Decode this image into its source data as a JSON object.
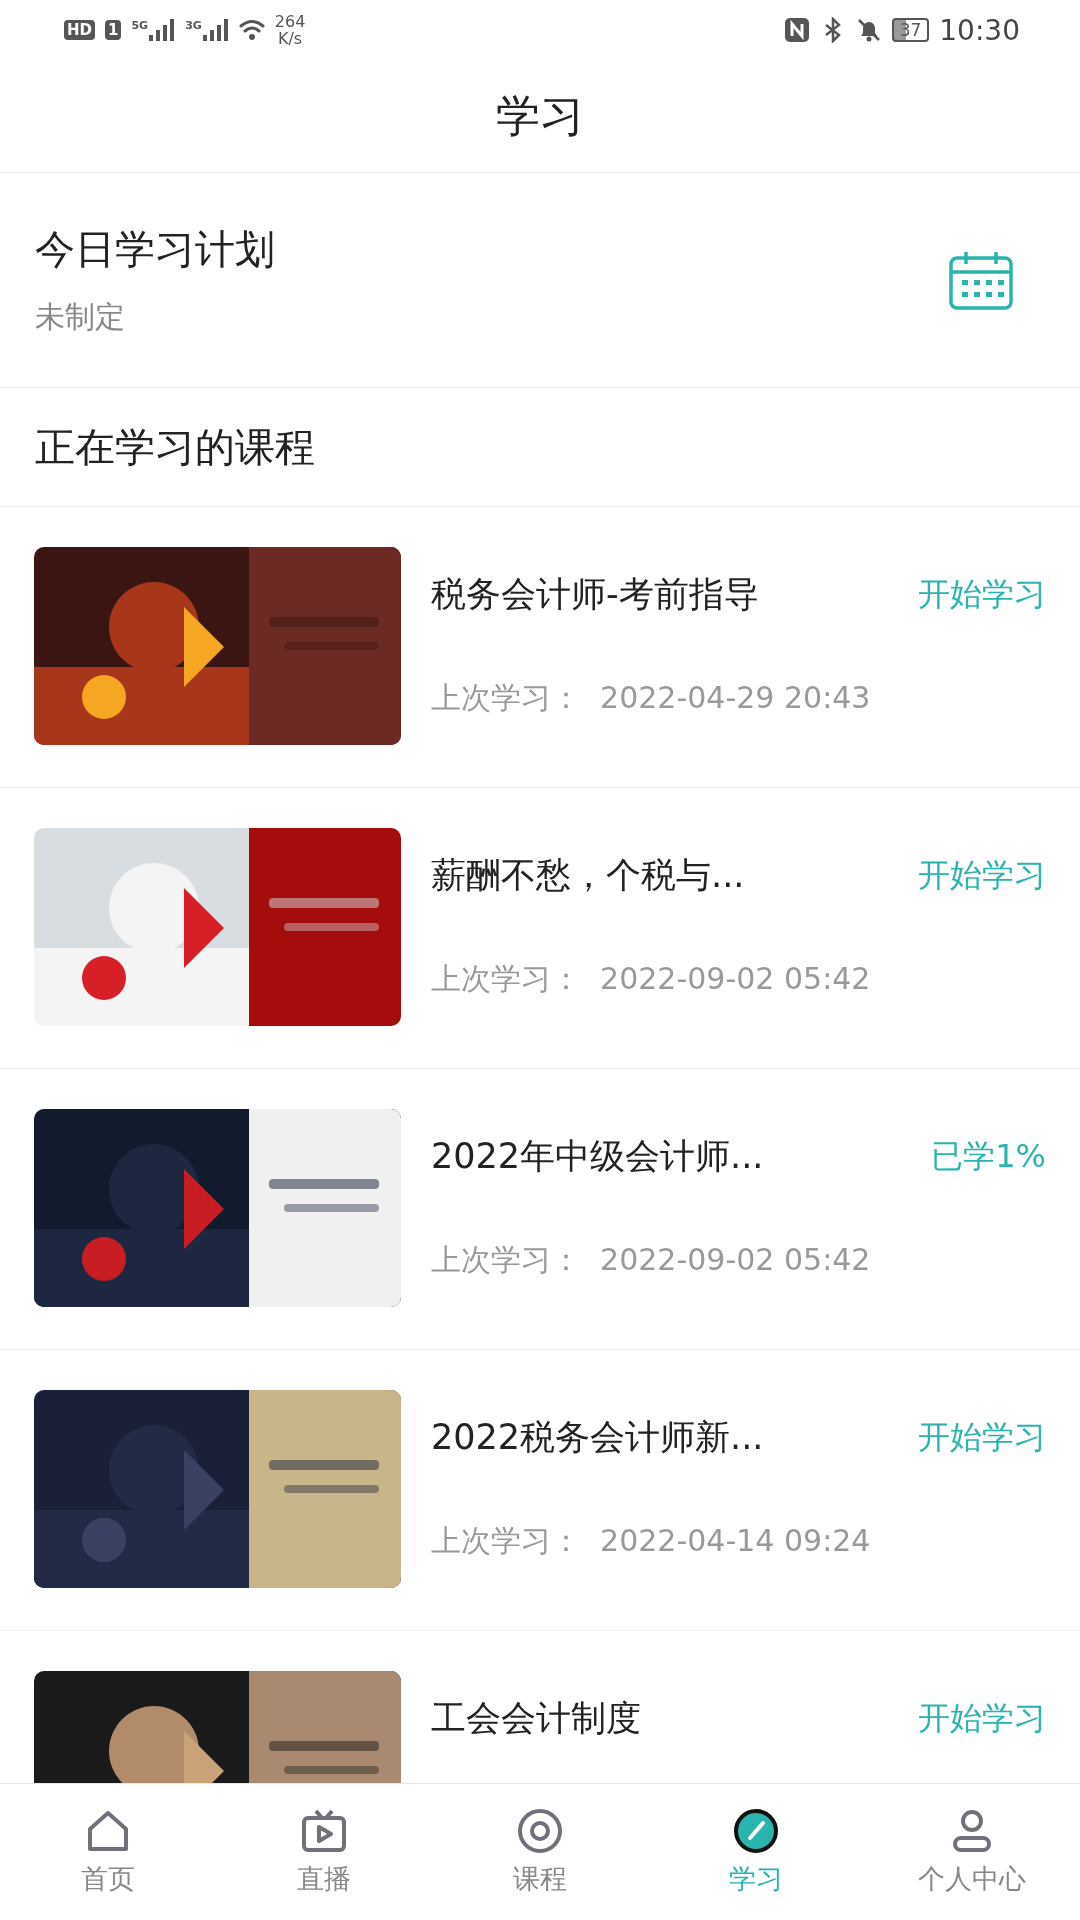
{
  "status_bar": {
    "left_badges": [
      "HD",
      "1"
    ],
    "networks": [
      "5G",
      "3G"
    ],
    "speed_value": "264",
    "speed_unit": "K/s",
    "battery": "37",
    "time": "10:30"
  },
  "header": {
    "title": "学习"
  },
  "plan": {
    "title": "今日学习计划",
    "status": "未制定"
  },
  "section_title": "正在学习的课程",
  "courses": [
    {
      "title": "税务会计师-考前指导",
      "action": "开始学习",
      "last_study": "上次学习：  2022-04-29 20:43"
    },
    {
      "title": "薪酬不愁，个税与...",
      "action": "开始学习",
      "last_study": "上次学习：  2022-09-02 05:42"
    },
    {
      "title": "2022年中级会计师...",
      "action": "已学1%",
      "last_study": "上次学习：  2022-09-02 05:42"
    },
    {
      "title": "2022税务会计师新...",
      "action": "开始学习",
      "last_study": "上次学习：  2022-04-14 09:24"
    },
    {
      "title": "工会会计制度",
      "action": "开始学习"
    }
  ],
  "tabbar": [
    {
      "kind": "home",
      "label": "首页",
      "selected": false
    },
    {
      "kind": "live",
      "label": "直播",
      "selected": false
    },
    {
      "kind": "course",
      "label": "课程",
      "selected": false
    },
    {
      "kind": "study",
      "label": "学习",
      "selected": true
    },
    {
      "kind": "profile",
      "label": "个人中心",
      "selected": false
    }
  ]
}
